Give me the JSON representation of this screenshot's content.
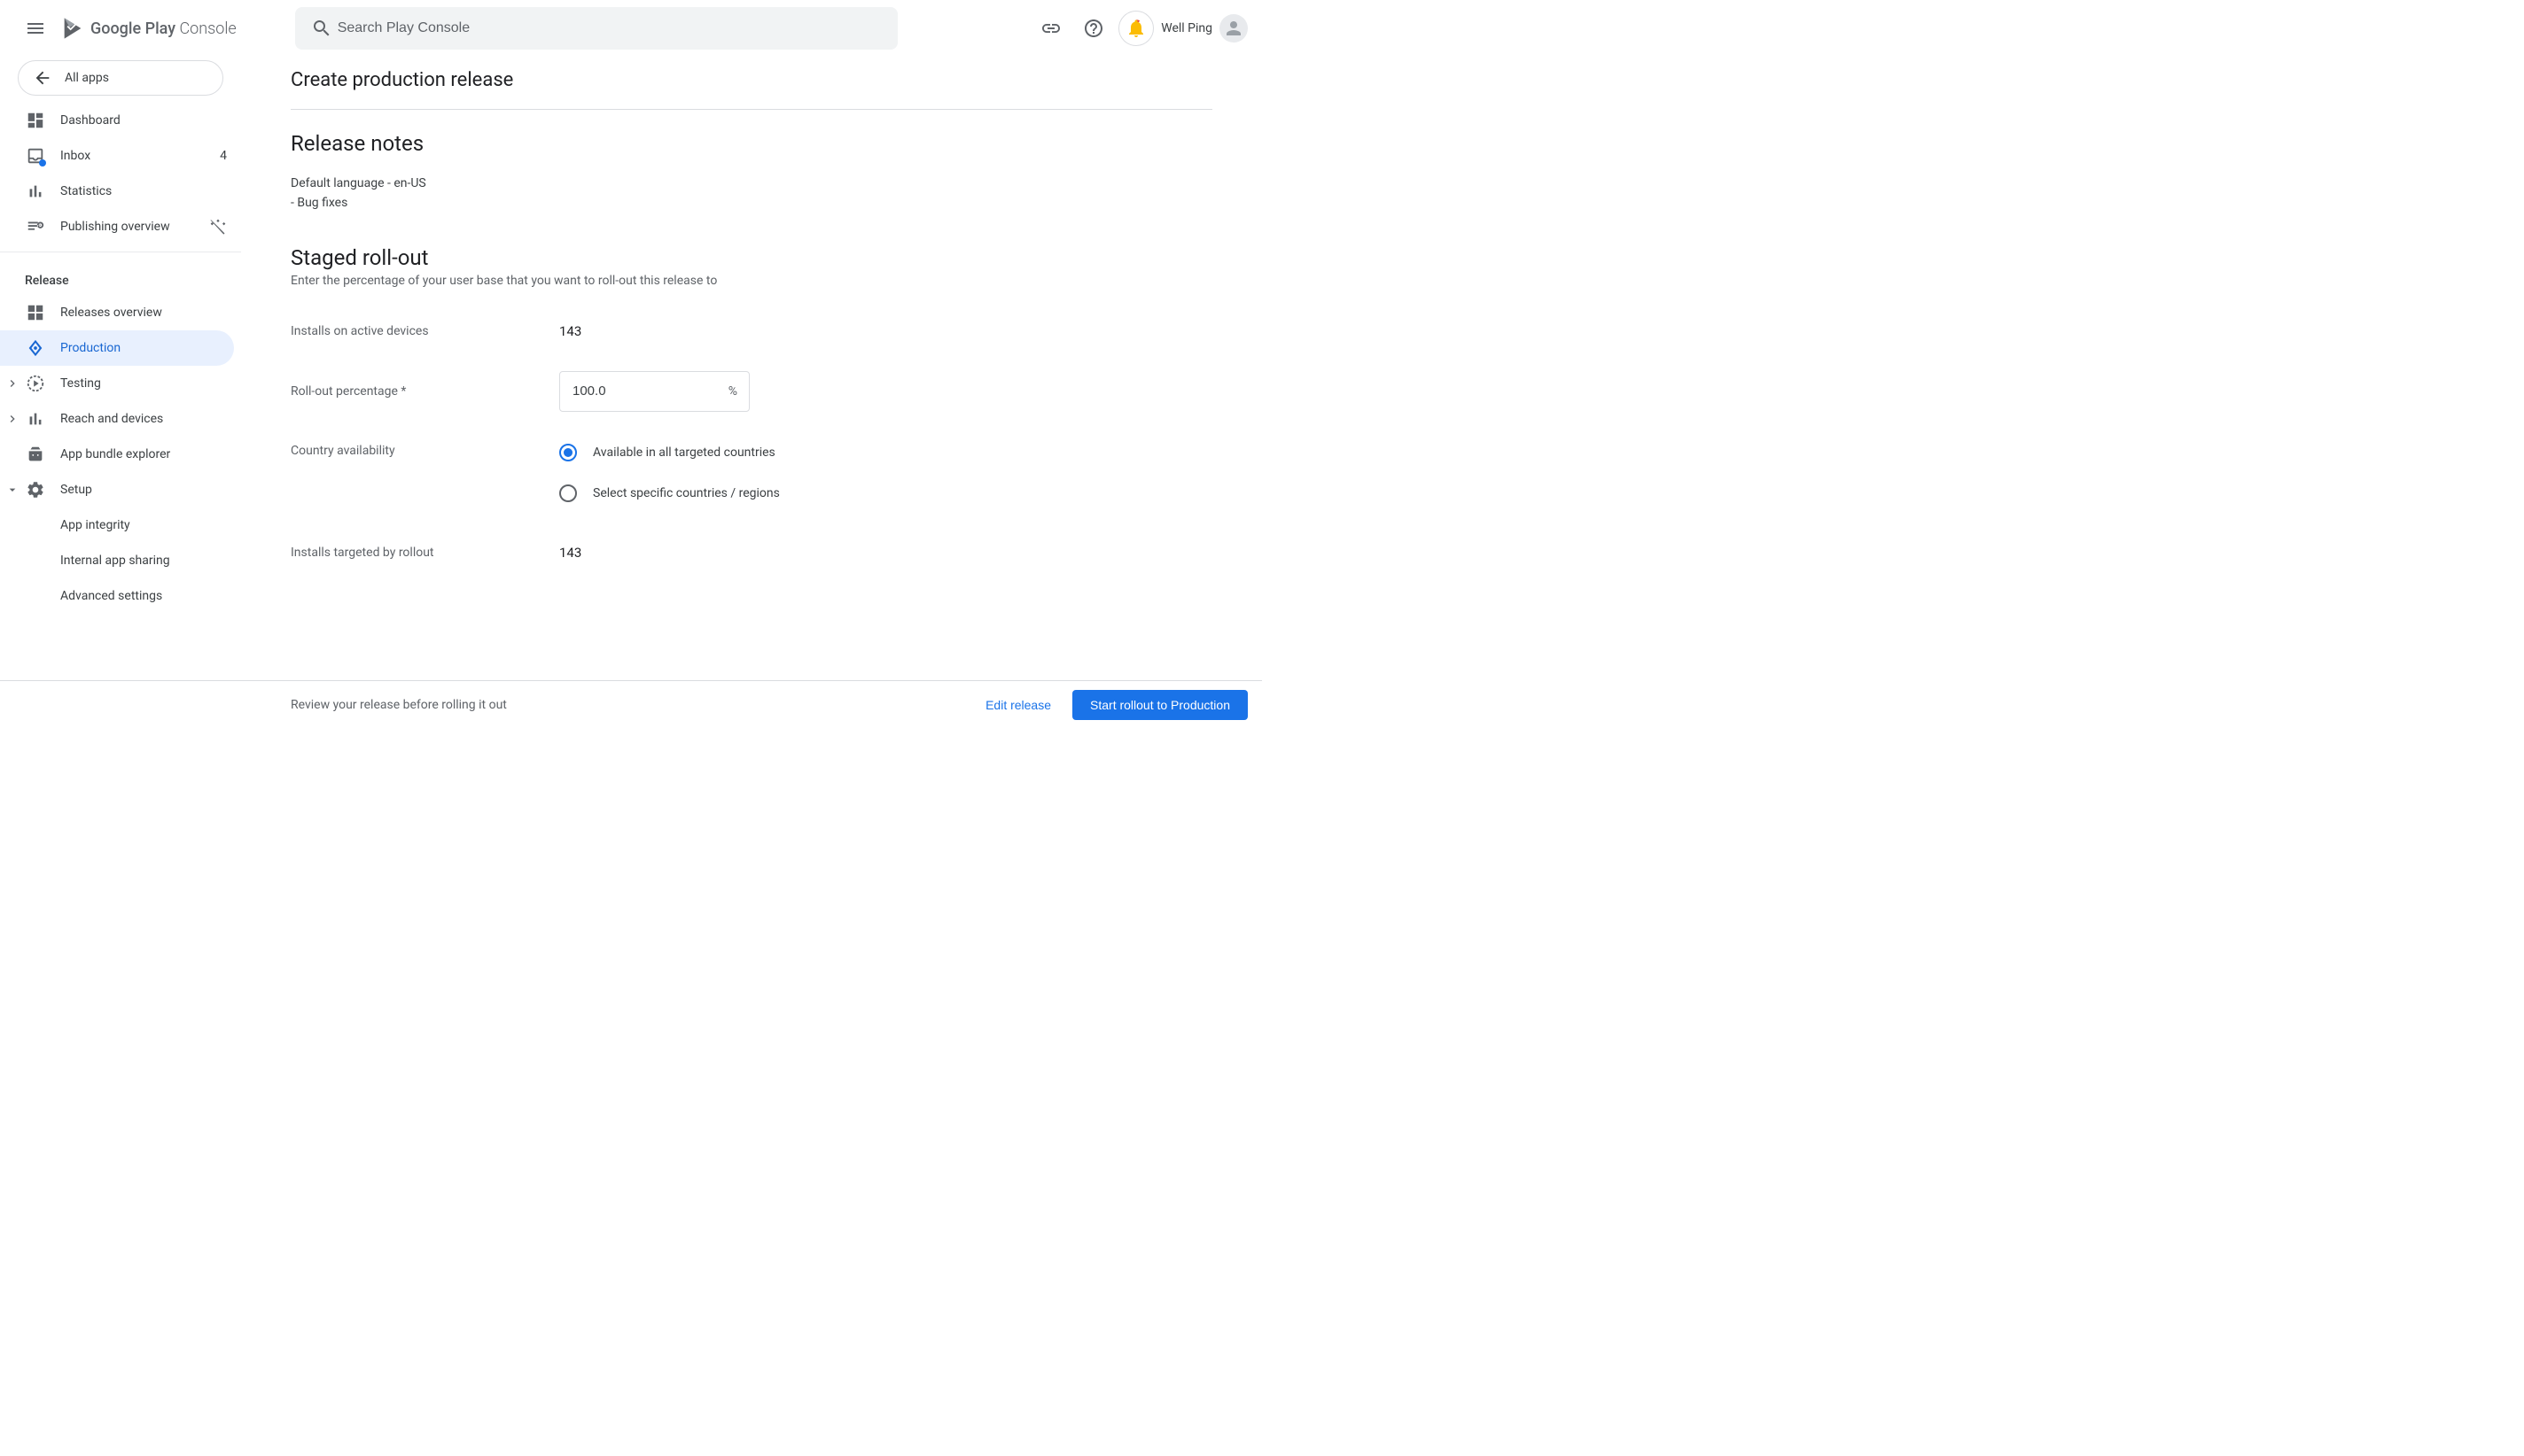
{
  "header": {
    "logo_play": "Google Play",
    "logo_console": " Console",
    "search_placeholder": "Search Play Console",
    "user_name": "Well Ping"
  },
  "sidebar": {
    "all_apps": "All apps",
    "nav": {
      "dashboard": "Dashboard",
      "inbox": "Inbox",
      "inbox_count": "4",
      "statistics": "Statistics",
      "publishing_overview": "Publishing overview"
    },
    "release_section": "Release",
    "release_nav": {
      "releases_overview": "Releases overview",
      "production": "Production",
      "testing": "Testing",
      "reach_devices": "Reach and devices",
      "app_bundle": "App bundle explorer",
      "setup": "Setup",
      "app_integrity": "App integrity",
      "internal_sharing": "Internal app sharing",
      "advanced_settings": "Advanced settings"
    }
  },
  "main": {
    "page_title": "Create production release",
    "release_notes_heading": "Release notes",
    "release_notes_line1": "Default language - en-US",
    "release_notes_line2": "- Bug fixes",
    "staged_heading": "Staged roll-out",
    "staged_desc": "Enter the percentage of your user base that you want to roll-out this release to",
    "installs_active_label": "Installs on active devices",
    "installs_active_value": "143",
    "rollout_pct_label": "Roll-out percentage  *",
    "rollout_pct_value": "100.0",
    "rollout_pct_suffix": "%",
    "country_label": "Country availability",
    "radio1": "Available in all targeted countries",
    "radio2": "Select specific countries / regions",
    "installs_targeted_label": "Installs targeted by rollout",
    "installs_targeted_value": "143"
  },
  "footer": {
    "review_text": "Review your release before rolling it out",
    "edit_btn": "Edit release",
    "start_btn": "Start rollout to Production"
  }
}
